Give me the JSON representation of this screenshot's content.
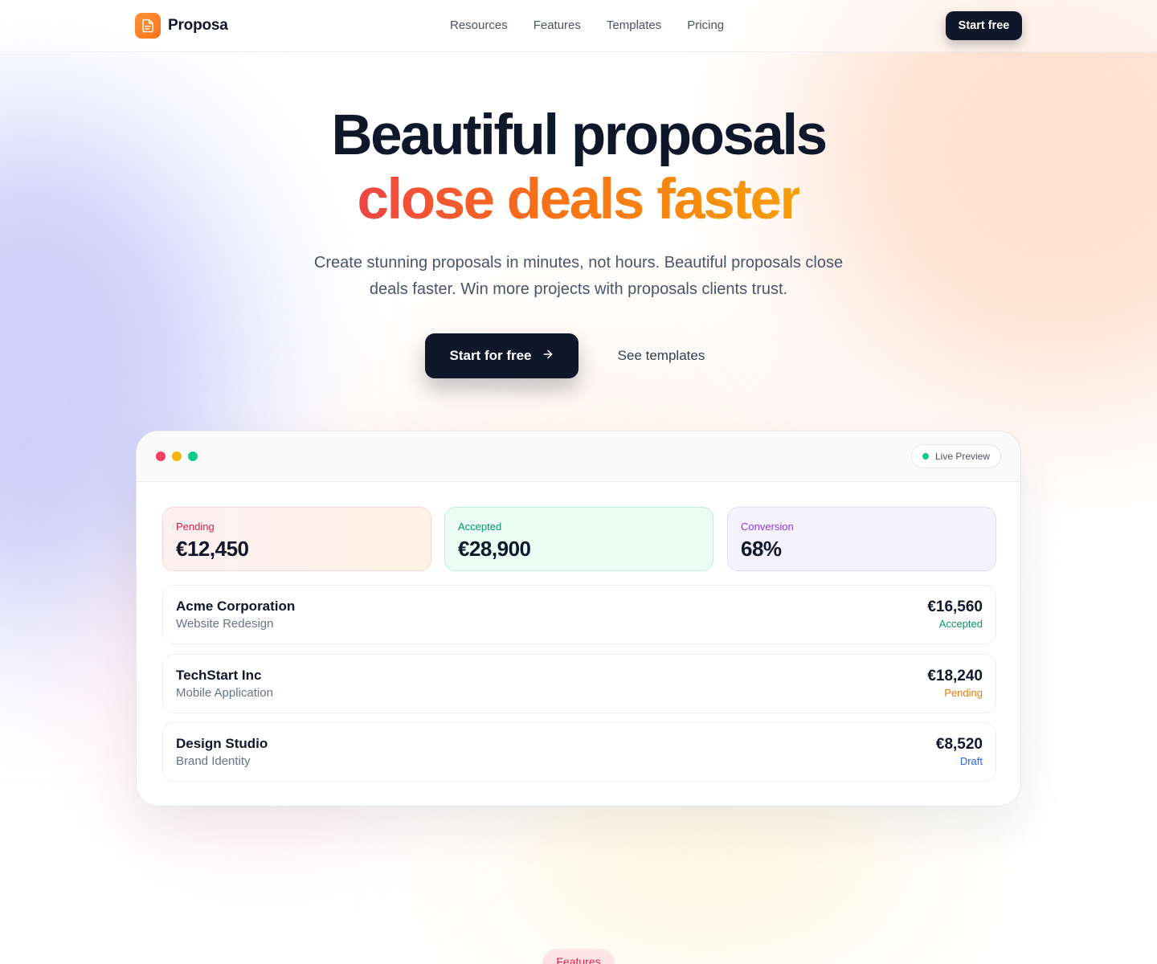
{
  "brand": {
    "name": "Proposa",
    "logo_icon": "document-icon",
    "accent": "#f97316"
  },
  "nav": {
    "links": [
      "Resources",
      "Features",
      "Templates",
      "Pricing"
    ],
    "cta_label": "Start free"
  },
  "hero": {
    "title_line1": "Beautiful proposals",
    "title_line2": "close deals faster",
    "subtitle": "Create stunning proposals in minutes, not hours. Beautiful proposals close deals faster. Win more projects with proposals clients trust.",
    "primary_cta": "Start for free",
    "primary_cta_icon": "arrow-right-icon",
    "secondary_cta": "See templates"
  },
  "preview": {
    "badge": "Live Preview",
    "stats": [
      {
        "label": "Pending",
        "value": "€12,450"
      },
      {
        "label": "Accepted",
        "value": "€28,900"
      },
      {
        "label": "Conversion",
        "value": "68%"
      }
    ],
    "proposals": [
      {
        "client": "Acme Corporation",
        "project": "Website Redesign",
        "amount": "€16,560",
        "status": "Accepted",
        "status_color": "#059669"
      },
      {
        "client": "TechStart Inc",
        "project": "Mobile Application",
        "amount": "€18,240",
        "status": "Pending",
        "status_color": "#ea7a0c"
      },
      {
        "client": "Design Studio",
        "project": "Brand Identity",
        "amount": "€8,520",
        "status": "Draft",
        "status_color": "#2563eb"
      }
    ]
  },
  "features_section": {
    "pill": "Features"
  }
}
